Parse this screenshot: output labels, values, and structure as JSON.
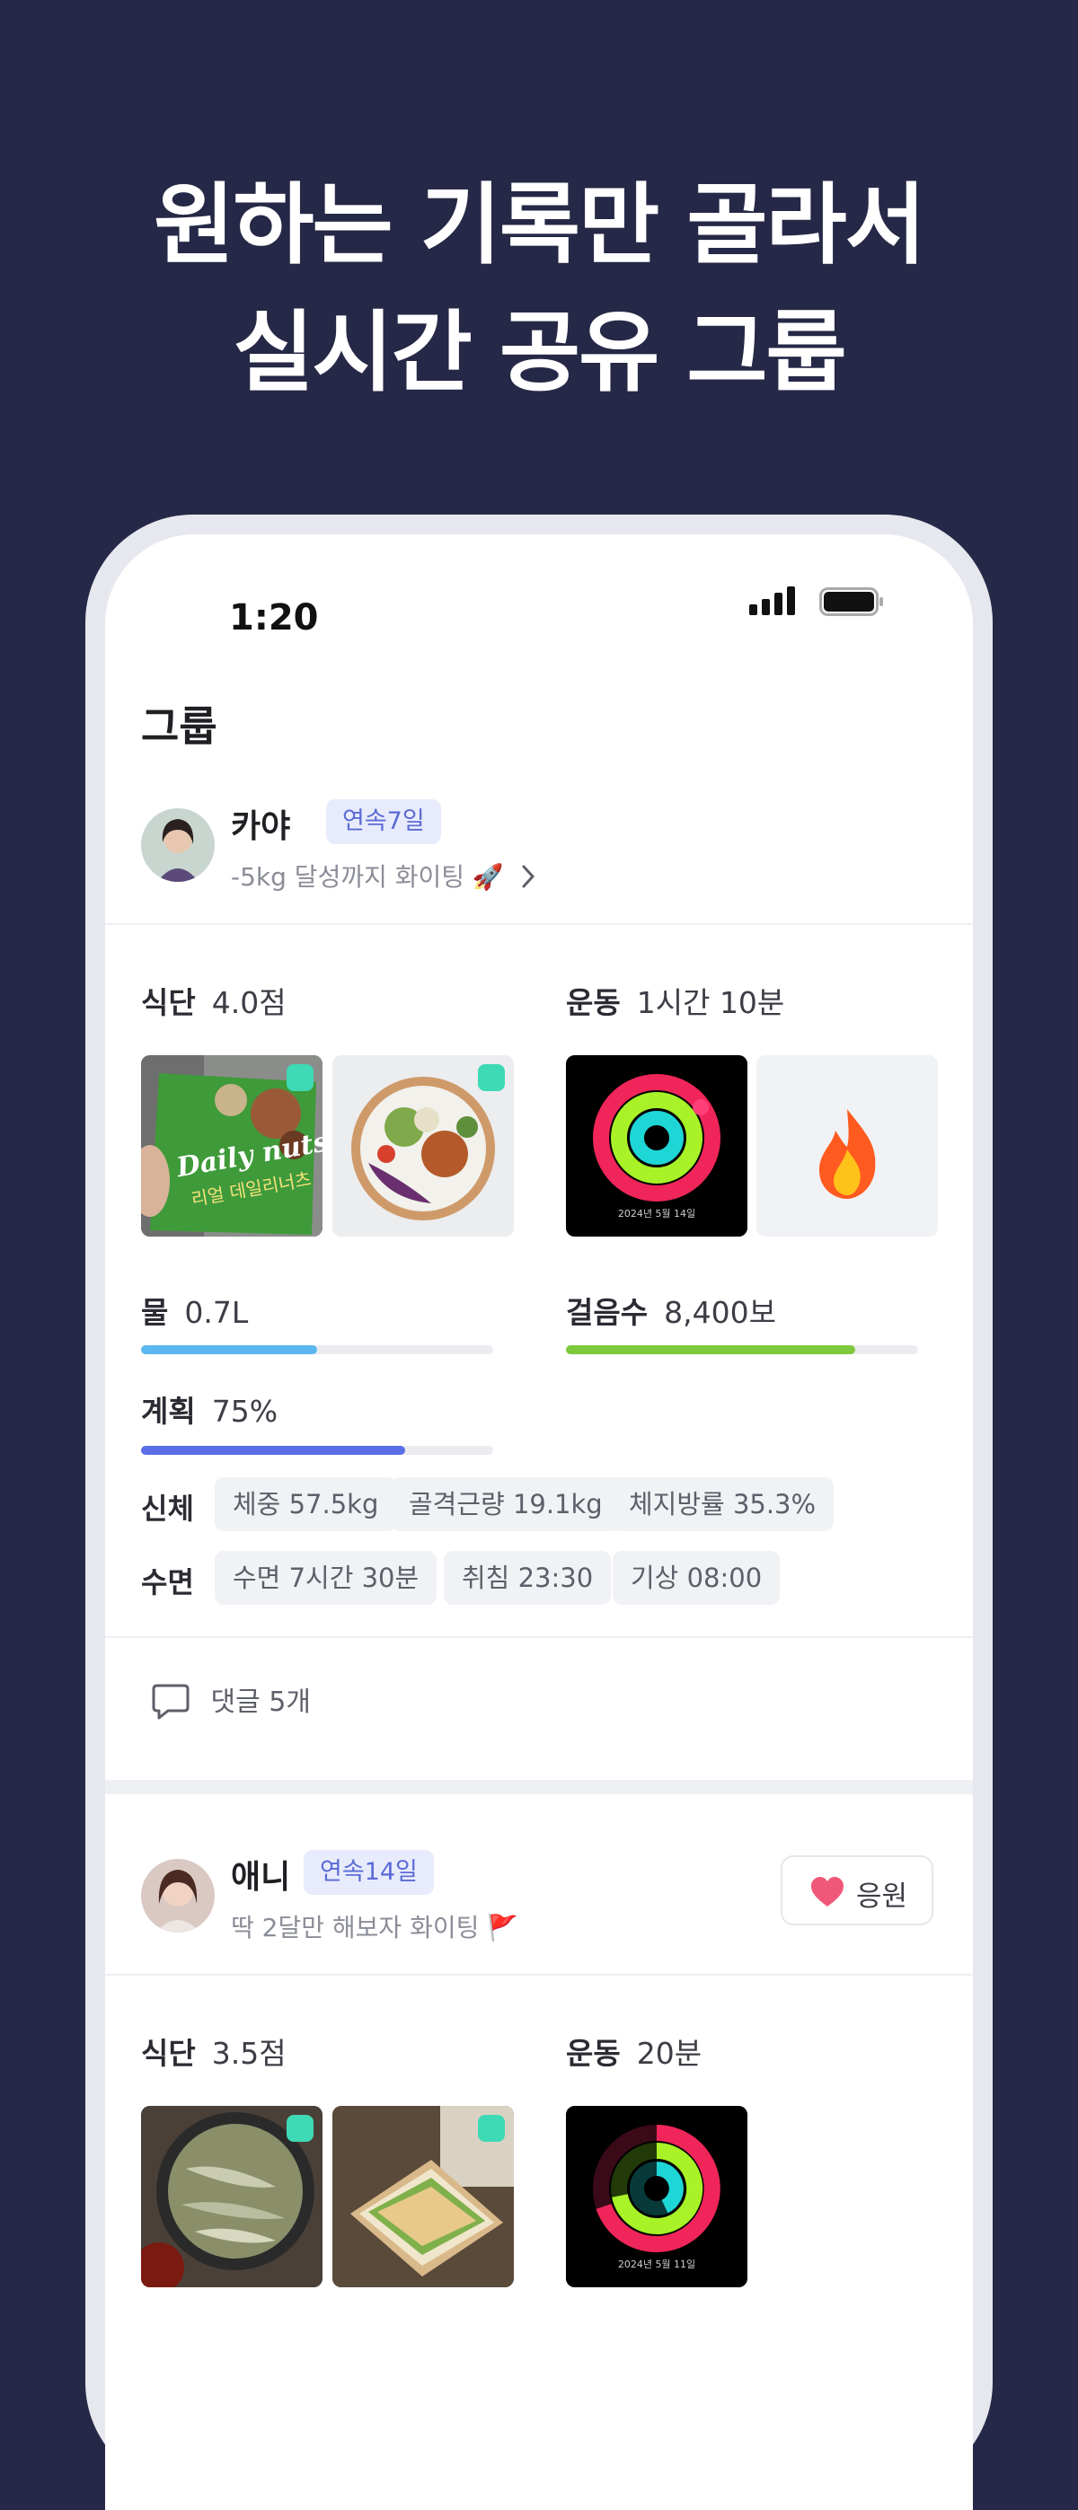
{
  "headline": {
    "line1": "원하는 기록만 골라서",
    "line2": "실시간 공유 그룹"
  },
  "status_bar": {
    "time": "1:20"
  },
  "page": {
    "title": "그룹"
  },
  "colors": {
    "background": "#262847",
    "accent": "#5a6bd6",
    "check": "#3ed9b5",
    "water": "#5ab8ef",
    "steps": "#7fc93e",
    "plan": "#5a6ee8"
  },
  "posts": [
    {
      "name": "카야",
      "streak": "연속7일",
      "status": "-5kg 달성까지 화이팅 🚀",
      "diet": {
        "label": "식단",
        "value": "4.0점"
      },
      "exercise": {
        "label": "운동",
        "value": "1시간 10분"
      },
      "exercise_date": "2024년 5월 14일",
      "water": {
        "label": "물",
        "value": "0.7L",
        "progress": 0.5
      },
      "steps": {
        "label": "걸음수",
        "value": "8,400보",
        "progress": 0.82
      },
      "plan": {
        "label": "계획",
        "value": "75%",
        "progress": 0.75
      },
      "body": {
        "label": "신체",
        "chips": [
          "체중 57.5kg",
          "골격근량 19.1kg",
          "체지방률 35.3%"
        ]
      },
      "sleep": {
        "label": "수면",
        "chips": [
          "수면 7시간 30분",
          "취침 23:30",
          "기상 08:00"
        ]
      },
      "comments": "댓글 5개",
      "photo_text": {
        "brand": "Daily nuts",
        "sub": "리얼 데일리너츠"
      }
    },
    {
      "name": "애니",
      "streak": "연속14일",
      "status": "딱 2달만 해보자 화이팅 🚩",
      "cheer": "응원",
      "diet": {
        "label": "식단",
        "value": "3.5점"
      },
      "exercise": {
        "label": "운동",
        "value": "20분"
      },
      "exercise_date": "2024년 5월 11일"
    }
  ]
}
